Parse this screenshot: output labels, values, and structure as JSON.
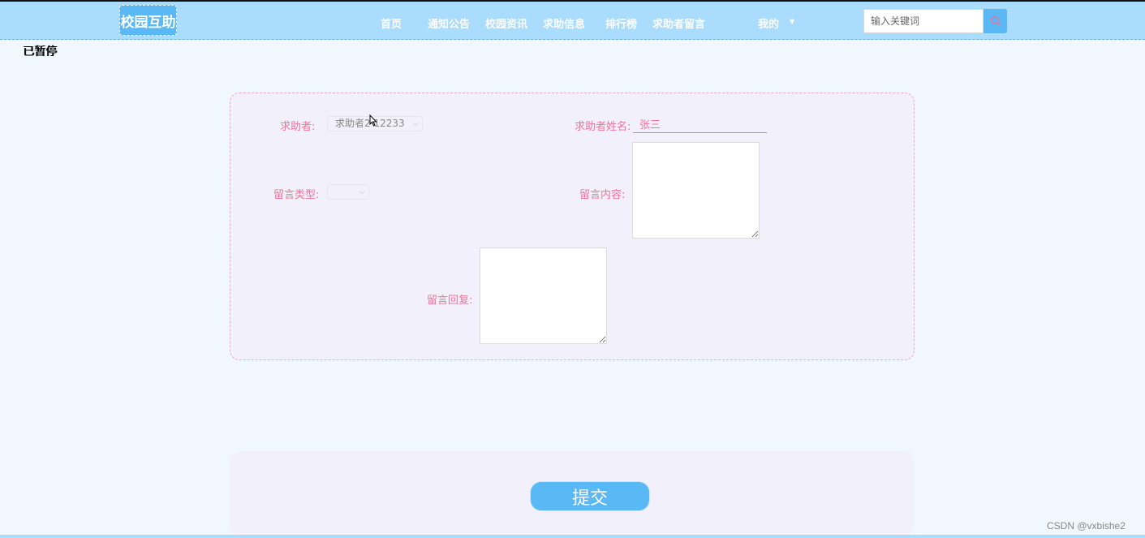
{
  "navbar": {
    "logo": "校园互助",
    "items": [
      "首页",
      "通知公告",
      "校园资讯",
      "求助信息",
      "排行榜",
      "求助者留言"
    ],
    "mine": "我的",
    "search_placeholder": "输入关键词"
  },
  "status": {
    "paused": "已暂停"
  },
  "form": {
    "seeker_label": "求助者:",
    "seeker_value": "求助者2 12233",
    "seeker_name_label": "求助者姓名:",
    "seeker_name_value": "张三",
    "message_type_label": "留言类型:",
    "message_type_value": "",
    "message_content_label": "留言内容:",
    "message_reply_label": "留言回复:"
  },
  "submit": {
    "label": "提交"
  },
  "watermark": "CSDN @vxbishe2",
  "colors": {
    "nav_bg": "#aadcfd",
    "accent": "#5ab8f4",
    "label_pink": "#f0739c"
  }
}
